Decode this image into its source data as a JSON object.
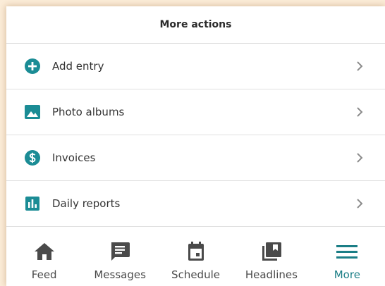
{
  "header": {
    "title": "More actions"
  },
  "actions": [
    {
      "label": "Add entry",
      "icon": "add-circle-icon"
    },
    {
      "label": "Photo albums",
      "icon": "photo-icon"
    },
    {
      "label": "Invoices",
      "icon": "dollar-circle-icon"
    },
    {
      "label": "Daily reports",
      "icon": "bar-chart-icon"
    }
  ],
  "tabs": [
    {
      "label": "Feed",
      "icon": "home-icon",
      "active": false
    },
    {
      "label": "Messages",
      "icon": "message-icon",
      "active": false
    },
    {
      "label": "Schedule",
      "icon": "calendar-icon",
      "active": false
    },
    {
      "label": "Headlines",
      "icon": "library-icon",
      "active": false
    },
    {
      "label": "More",
      "icon": "menu-icon",
      "active": true
    }
  ],
  "colors": {
    "accent": "#1b8c95",
    "active_tab": "#1b7e86",
    "tab_icon": "#4a4a4a",
    "background": "#fbecd8"
  }
}
